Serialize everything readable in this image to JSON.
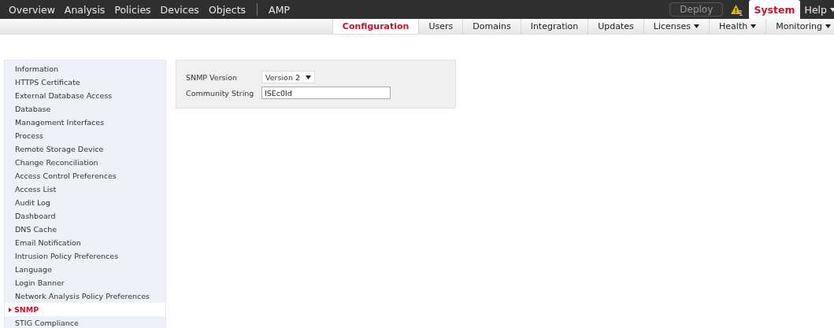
{
  "top_nav": {
    "items": [
      {
        "label": "Overview",
        "selected": false
      },
      {
        "label": "Analysis",
        "selected": false
      },
      {
        "label": "Policies",
        "selected": false
      },
      {
        "label": "Devices",
        "selected": false
      },
      {
        "label": "Objects",
        "selected": false
      },
      {
        "label": "AMP",
        "selected": false
      }
    ],
    "deploy_button": "Deploy",
    "alert_count": "1",
    "right_tabs": [
      {
        "label": "System",
        "selected": true,
        "has_menu": false
      },
      {
        "label": "Help",
        "selected": false,
        "has_menu": true
      }
    ]
  },
  "sub_nav": {
    "tabs": [
      {
        "label": "Configuration",
        "selected": true,
        "has_menu": false
      },
      {
        "label": "Users",
        "selected": false,
        "has_menu": false
      },
      {
        "label": "Domains",
        "selected": false,
        "has_menu": false
      },
      {
        "label": "Integration",
        "selected": false,
        "has_menu": false
      },
      {
        "label": "Updates",
        "selected": false,
        "has_menu": false
      },
      {
        "label": "Licenses",
        "selected": false,
        "has_menu": true
      },
      {
        "label": "Health",
        "selected": false,
        "has_menu": true
      },
      {
        "label": "Monitoring",
        "selected": false,
        "has_menu": true
      }
    ]
  },
  "sidebar": {
    "items": [
      {
        "label": "Information",
        "selected": false
      },
      {
        "label": "HTTPS Certificate",
        "selected": false
      },
      {
        "label": "External Database Access",
        "selected": false
      },
      {
        "label": "Database",
        "selected": false
      },
      {
        "label": "Management Interfaces",
        "selected": false
      },
      {
        "label": "Process",
        "selected": false
      },
      {
        "label": "Remote Storage Device",
        "selected": false
      },
      {
        "label": "Change Reconciliation",
        "selected": false
      },
      {
        "label": "Access Control Preferences",
        "selected": false
      },
      {
        "label": "Access List",
        "selected": false
      },
      {
        "label": "Audit Log",
        "selected": false
      },
      {
        "label": "Dashboard",
        "selected": false
      },
      {
        "label": "DNS Cache",
        "selected": false
      },
      {
        "label": "Email Notification",
        "selected": false
      },
      {
        "label": "Intrusion Policy Preferences",
        "selected": false
      },
      {
        "label": "Language",
        "selected": false
      },
      {
        "label": "Login Banner",
        "selected": false
      },
      {
        "label": "Network Analysis Policy Preferences",
        "selected": false
      },
      {
        "label": "SNMP",
        "selected": true
      },
      {
        "label": "STIG Compliance",
        "selected": false
      }
    ]
  },
  "snmp_form": {
    "fields": [
      {
        "kind": "select",
        "label": "SNMP Version",
        "value": "Version 2"
      },
      {
        "kind": "text",
        "label": "Community String",
        "value": "ISEc0ld"
      }
    ]
  }
}
